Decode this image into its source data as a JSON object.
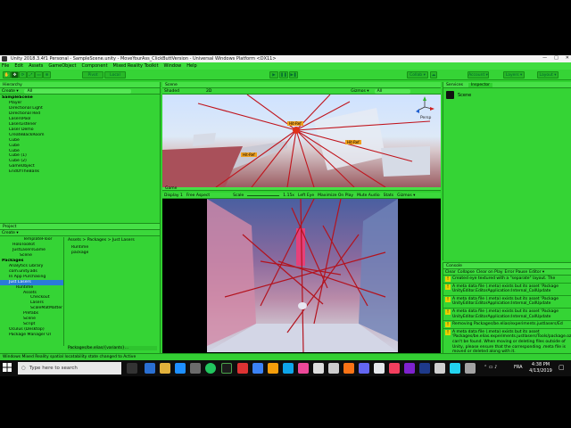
{
  "window": {
    "title": "Unity 2018.3.4f1 Personal - SampleScene.unity - MoveYourAss_ClickButtVersion - Universal Windows Platform <DX11>",
    "controls": [
      "—",
      "□",
      "✕"
    ]
  },
  "menu": [
    "File",
    "Edit",
    "Assets",
    "GameObject",
    "Component",
    "Mixed Reality Toolkit",
    "Window",
    "Help"
  ],
  "toolbar": {
    "pivot": "Pivot",
    "local": "Local",
    "play": "▶",
    "pause": "❚❚",
    "step": "▶❚",
    "collab": "Collab ▾",
    "account": "Account ▾",
    "layers": "Layers ▾",
    "layout": "Layout ▾"
  },
  "hierarchy": {
    "tab": "Hierarchy",
    "create": "Create ▾",
    "search_placeholder": "All",
    "items": [
      "SampleScene",
      "Player",
      "Directional Light",
      "Directional Red",
      "LasersPool",
      "LaserListener",
      "Laser Demo",
      "CreateBackRoom",
      "Cube",
      "Cube",
      "Cube",
      "Cube (1)",
      "Cube (2)",
      "GameObject",
      "EndOfTheBank"
    ]
  },
  "scene": {
    "tab": "Scene",
    "shading": "Shaded",
    "mode2d": "2D",
    "gizmos": "Gizmos ▾",
    "search_placeholder": "All",
    "persp": "Persp",
    "labels": [
      "Hit-Ref",
      "Hit-Ref",
      "Hit-Ref"
    ]
  },
  "game": {
    "tab": "Game",
    "display": "Display 1",
    "aspect": "Free Aspect",
    "scale_label": "Scale",
    "scale_value": "1.15x",
    "options": [
      "Maximize On Play",
      "Mute Audio",
      "Stats",
      "Gizmos ▾"
    ],
    "left_eye": "Left Eye"
  },
  "services": {
    "tab": "Services",
    "inspector_tab": "Inspector",
    "name": "Scene"
  },
  "project": {
    "tab": "Project",
    "create": "Create ▾",
    "breadcrumb": "Assets > Packages > Just Lasers",
    "tree": [
      "TemplateFloor",
      "HoloToolkit",
      "JustLasersGame",
      "Scene",
      "Packages",
      "Analytics Library",
      "com.unity.ads",
      "In App Purchasing",
      "Just Lasers",
      "Runtime",
      "Assets",
      "Checkout",
      "Lasers",
      "ScaleMatMatter",
      "Prefabs",
      "Scene",
      "Script",
      "Oculus (Desktop)",
      "Package Manager UI"
    ],
    "files": [
      "Runtime",
      "package"
    ],
    "path": "Packages/be.elias/{variants}..."
  },
  "console": {
    "tab": "Console",
    "buttons": [
      "Clear",
      "Collapse",
      "Clear on Play",
      "Error Pause",
      "Editor ▾"
    ],
    "messages": [
      "Created eye textured with a \"separate\" layout. The",
      "A meta data file (.meta) exists but its asset 'Package UnityEditor.EditorApplication:Internal_CallUpdate",
      "A meta data file (.meta) exists but its asset 'Package UnityEditor.EditorApplication:Internal_CallUpdate",
      "A meta data file (.meta) exists but its asset 'Package UnityEditor.EditorApplication:Internal_CallUpdate",
      "Removing Packages/be.elias/experiments.justlasers/Ed",
      "A meta data file (.meta) exists but its asset 'Packages/be.elias.experiments.justlasers/Tools/package.ozz.js' can't be found. When moving or deleting files outside of Unity, please ensure that the corresponding .meta file is moved or deleted along with it."
    ]
  },
  "status": "Windows Mixed Reality spatial locatability state changed to Active",
  "taskbar": {
    "search_placeholder": "Type here to search",
    "lang": "FRA",
    "time": "4:38 PM",
    "date": "4/13/2019"
  },
  "colors": {
    "unity_green": "#2fd12f",
    "selection": "#2a7bd8",
    "laser": "#c0141c"
  }
}
